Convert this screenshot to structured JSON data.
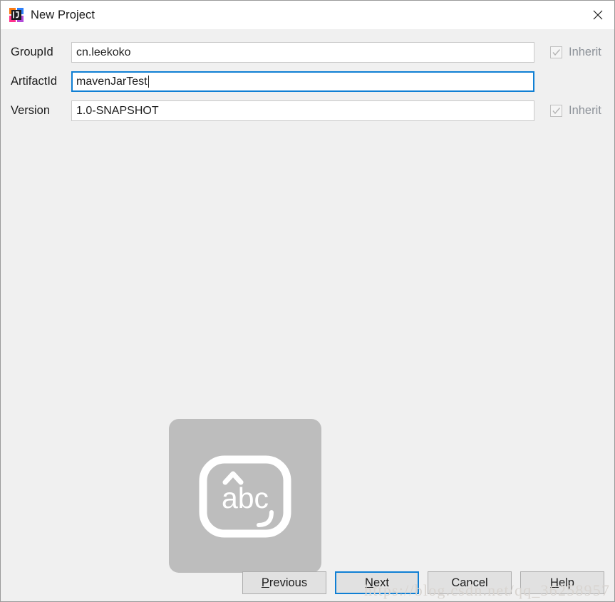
{
  "window": {
    "title": "New Project",
    "icon": "intellij-idea-icon",
    "close_label": "✕",
    "background": "#f0f0f0",
    "titlebar_background": "#ffffff",
    "accent_color": "#0f7fd4"
  },
  "form": {
    "rows": [
      {
        "label": "GroupId",
        "value": "cn.leekoko",
        "focused": false,
        "inherit": {
          "label": "Inherit",
          "checked": true,
          "disabled": true
        }
      },
      {
        "label": "ArtifactId",
        "value": "mavenJarTest",
        "focused": true,
        "inherit": null
      },
      {
        "label": "Version",
        "value": "1.0-SNAPSHOT",
        "focused": false,
        "inherit": {
          "label": "Inherit",
          "checked": true,
          "disabled": true
        }
      }
    ]
  },
  "ime_overlay": {
    "name": "ime-mode-indicator",
    "text": "abc",
    "background": "#bdbdbd"
  },
  "watermark": {
    "text": "https://blog.csdn.net/qq_36258957"
  },
  "buttons": [
    {
      "name": "previous-button",
      "label_pre": "",
      "mnemonic": "P",
      "label_post": "revious",
      "default": false
    },
    {
      "name": "next-button",
      "label_pre": "",
      "mnemonic": "N",
      "label_post": "ext",
      "default": true
    },
    {
      "name": "cancel-button",
      "label_pre": "Cancel",
      "mnemonic": "",
      "label_post": "",
      "default": false
    },
    {
      "name": "help-button",
      "label_pre": "",
      "mnemonic": "H",
      "label_post": "elp",
      "default": false
    }
  ]
}
